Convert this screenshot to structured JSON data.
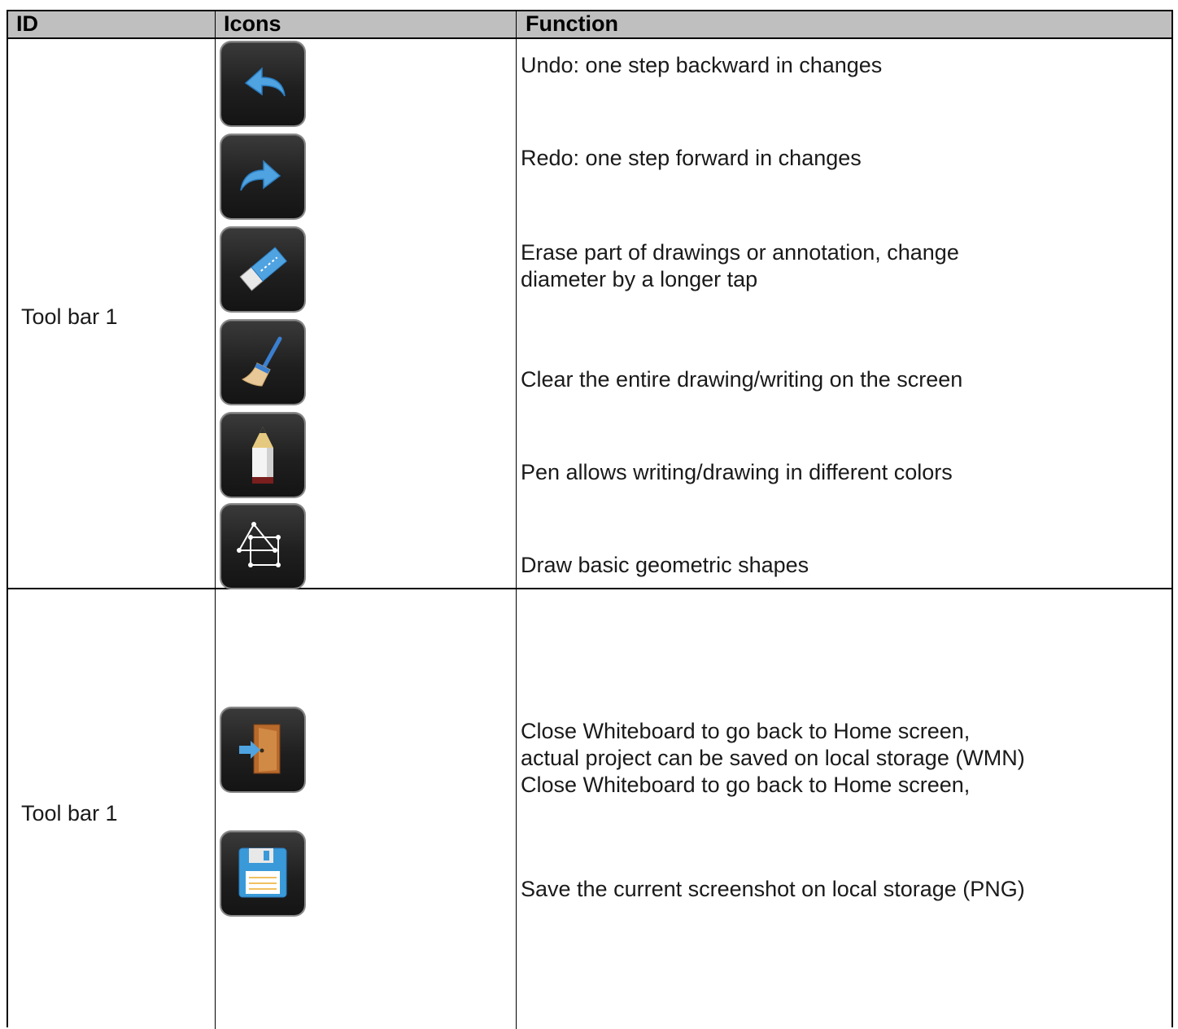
{
  "header": {
    "col_id": "ID",
    "col_icons": "Icons",
    "col_function": "Function"
  },
  "rows": [
    {
      "id": "Tool bar 1",
      "items": [
        {
          "icon": "undo-icon",
          "text": "Undo: one step backward in changes"
        },
        {
          "icon": "redo-icon",
          "text": "Redo: one step forward in changes"
        },
        {
          "icon": "eraser-icon",
          "text": "Erase part of drawings or annotation, change\ndiameter by a longer tap"
        },
        {
          "icon": "broom-icon",
          "text": "Clear the entire drawing/writing on the screen"
        },
        {
          "icon": "pen-icon",
          "text": "Pen allows writing/drawing in different colors"
        },
        {
          "icon": "shapes-icon",
          "text": "Draw basic geometric shapes"
        }
      ]
    },
    {
      "id": "Tool bar 1",
      "items": [
        {
          "icon": "exit-door-icon",
          "text": "Close Whiteboard to go back to Home screen,\nactual project can be saved on local storage (WMN)\nClose Whiteboard to go back to Home screen,"
        },
        {
          "icon": "save-disk-icon",
          "text": "Save the current screenshot on local storage (PNG)"
        }
      ]
    }
  ],
  "colors": {
    "header_bg": "#bfbfbf",
    "icon_bg": "#1f1f1f",
    "icon_blue": "#3a9ad9"
  }
}
